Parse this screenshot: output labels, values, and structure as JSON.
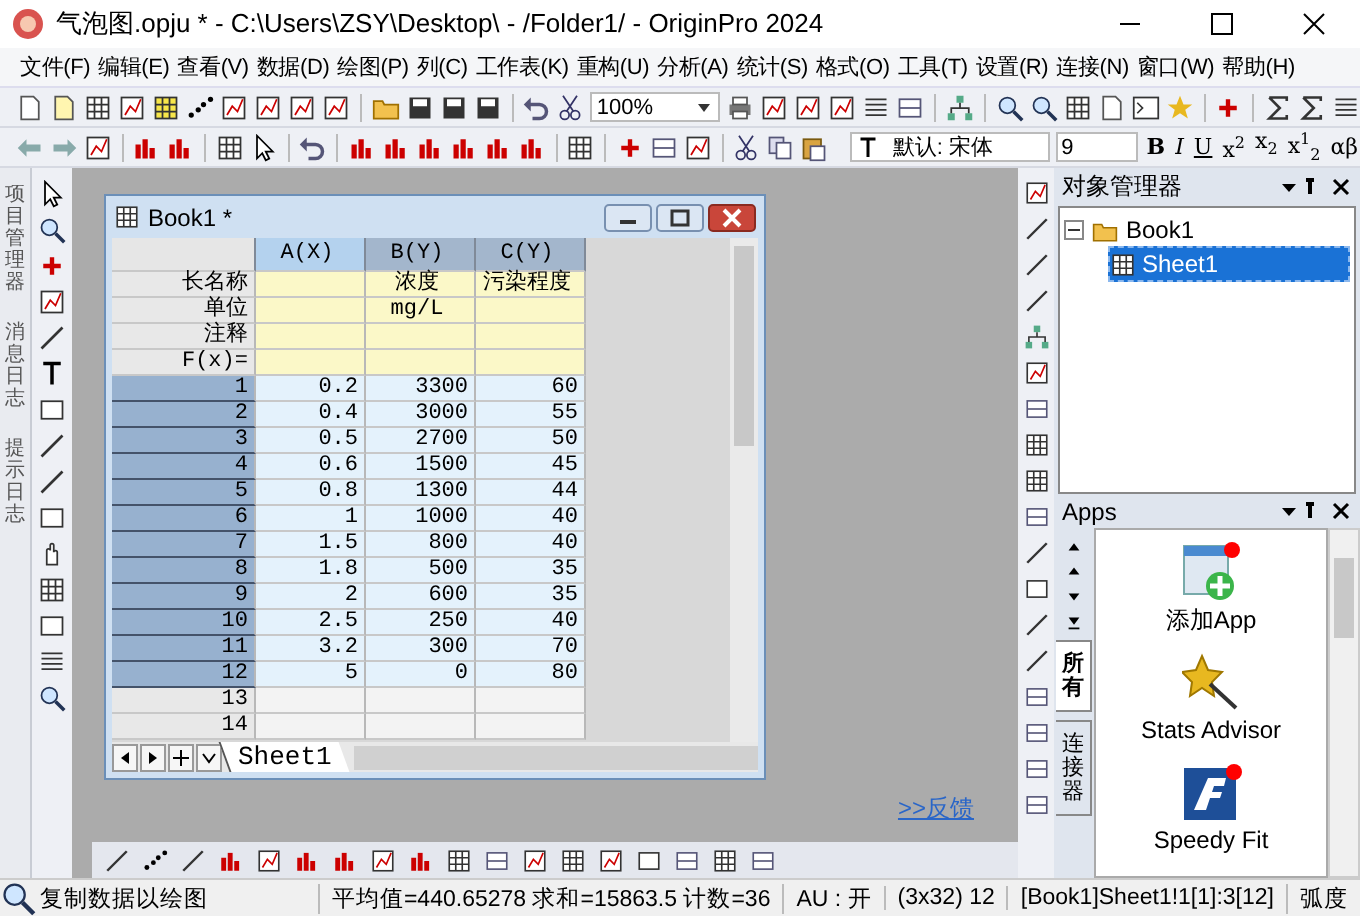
{
  "window": {
    "title": "气泡图.opju * - C:\\Users\\ZSY\\Desktop\\ - /Folder1/ - OriginPro 2024"
  },
  "menu": [
    "文件(F)",
    "编辑(E)",
    "查看(V)",
    "数据(D)",
    "绘图(P)",
    "列(C)",
    "工作表(K)",
    "重构(U)",
    "分析(A)",
    "统计(S)",
    "格式(O)",
    "工具(T)",
    "设置(R)",
    "连接(N)",
    "窗口(W)",
    "帮助(H)"
  ],
  "toolbar": {
    "zoom": "100%",
    "font": "默认: 宋体",
    "font_size": "9",
    "format_buttons": [
      {
        "label": "B",
        "kind": "bold"
      },
      {
        "label": "I",
        "kind": "italic"
      },
      {
        "label": "U",
        "kind": "underline"
      },
      {
        "label": "x$^{2}$",
        "kind": "plain"
      },
      {
        "label": "x$_{2}$",
        "kind": "plain"
      },
      {
        "label": "x$^{1}$$_{2}$",
        "kind": "plain"
      },
      {
        "label": "αβ",
        "kind": "plain"
      }
    ]
  },
  "side_tabs": [
    "项目管理器",
    "消息日志",
    "提示日志"
  ],
  "workbook": {
    "title": "Book1 *",
    "columns": [
      {
        "label": "A(X)",
        "selected": true
      },
      {
        "label": "B(Y)",
        "selected": false
      },
      {
        "label": "C(Y)",
        "selected": false
      }
    ],
    "label_rows": [
      {
        "name": "长名称",
        "cells": [
          null,
          "浓度",
          "污染程度"
        ]
      },
      {
        "name": "单位",
        "cells": [
          null,
          "mg/L",
          null
        ]
      },
      {
        "name": "注释",
        "cells": [
          null,
          null,
          null
        ]
      },
      {
        "name": "F(x)=",
        "cells": [
          null,
          null,
          null
        ]
      }
    ],
    "rows": [
      {
        "index": "1",
        "selected": true,
        "cells": [
          "0.2",
          "3300",
          "60"
        ]
      },
      {
        "index": "2",
        "selected": true,
        "cells": [
          "0.4",
          "3000",
          "55"
        ]
      },
      {
        "index": "3",
        "selected": true,
        "cells": [
          "0.5",
          "2700",
          "50"
        ]
      },
      {
        "index": "4",
        "selected": true,
        "cells": [
          "0.6",
          "1500",
          "45"
        ]
      },
      {
        "index": "5",
        "selected": true,
        "cells": [
          "0.8",
          "1300",
          "44"
        ]
      },
      {
        "index": "6",
        "selected": true,
        "cells": [
          "1",
          "1000",
          "40"
        ]
      },
      {
        "index": "7",
        "selected": true,
        "cells": [
          "1.5",
          "800",
          "40"
        ]
      },
      {
        "index": "8",
        "selected": true,
        "cells": [
          "1.8",
          "500",
          "35"
        ]
      },
      {
        "index": "9",
        "selected": true,
        "cells": [
          "2",
          "600",
          "35"
        ]
      },
      {
        "index": "10",
        "selected": true,
        "cells": [
          "2.5",
          "250",
          "40"
        ]
      },
      {
        "index": "11",
        "selected": true,
        "cells": [
          "3.2",
          "300",
          "70"
        ]
      },
      {
        "index": "12",
        "selected": true,
        "cells": [
          "5",
          "0",
          "80"
        ]
      },
      {
        "index": "13",
        "selected": false,
        "cells": [
          null,
          null,
          null
        ]
      },
      {
        "index": "14",
        "selected": false,
        "cells": [
          null,
          null,
          null
        ]
      }
    ],
    "sheets": [
      {
        "label": "Sheet1",
        "selected": true
      }
    ]
  },
  "feedback_link": ">>反馈",
  "object_manager": {
    "title": "对象管理器",
    "tree": [
      {
        "label": "Book1",
        "expanded": true,
        "children": [
          {
            "label": "Sheet1",
            "selected": true
          }
        ]
      }
    ]
  },
  "apps": {
    "title": "Apps",
    "tabs": [
      {
        "label": "所有",
        "selected": true
      },
      {
        "label": "连接器",
        "selected": false
      }
    ],
    "items": [
      {
        "label": "添加App",
        "kind": "add"
      },
      {
        "label": "Stats Advisor",
        "kind": "wand"
      },
      {
        "label": "Speedy Fit",
        "kind": "fit"
      }
    ]
  },
  "status_bar": {
    "message": "复制数据以绘图",
    "stats": "平均值=440.65278 求和=15863.5 计数=36",
    "au": "AU : 开",
    "size": "(3x32) 12",
    "range": "[Book1]Sheet1!1[1]:3[12]",
    "angle": "弧度"
  }
}
